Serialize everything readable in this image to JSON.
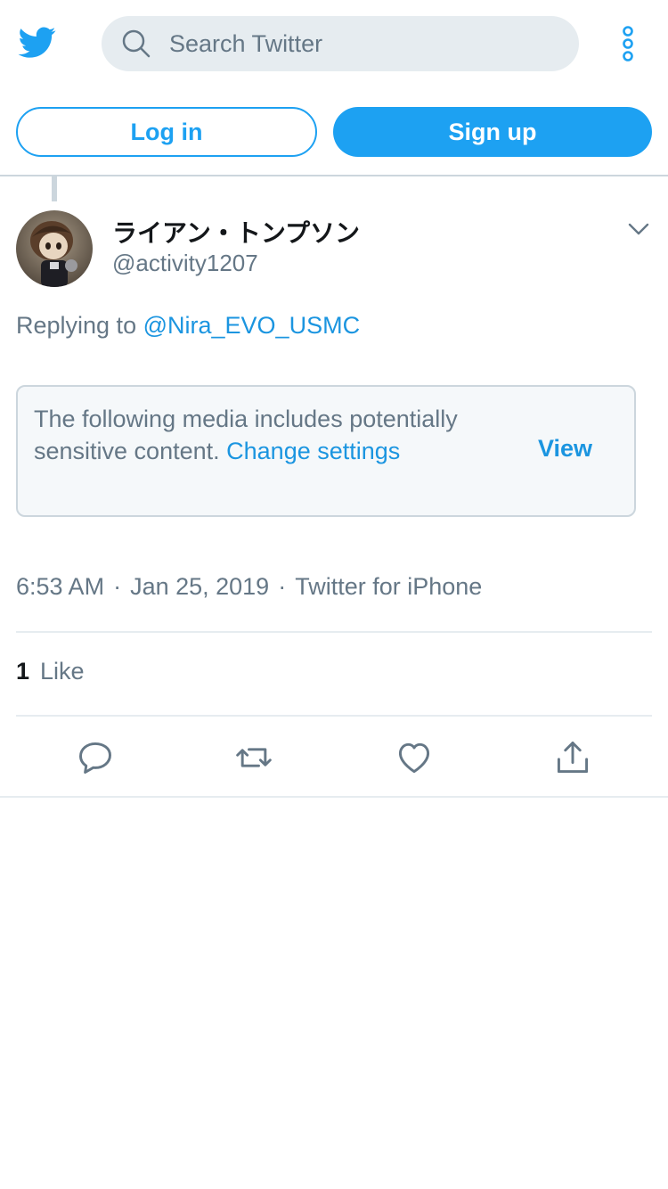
{
  "header": {
    "logo_icon": "twitter-bird-icon",
    "search_placeholder": "Search Twitter",
    "search_icon": "search-icon",
    "more_icon": "more-vertical-icon",
    "accent_color": "#1da1f2"
  },
  "auth": {
    "login_label": "Log in",
    "signup_label": "Sign up"
  },
  "tweet": {
    "display_name": "ライアン・トンプソン",
    "handle": "@activity1207",
    "reply_prefix": "Replying to",
    "reply_mention": "@Nira_EVO_USMC",
    "sensitive_text": "The following media includes potentially sensitive content.",
    "sensitive_link": "Change settings",
    "sensitive_view": "View",
    "time": "6:53 AM",
    "date": "Jan 25, 2019",
    "source": "Twitter for iPhone",
    "likes_count": "1",
    "likes_label": "Like"
  },
  "actions": [
    "reply-icon",
    "retweet-icon",
    "like-icon",
    "share-icon"
  ]
}
